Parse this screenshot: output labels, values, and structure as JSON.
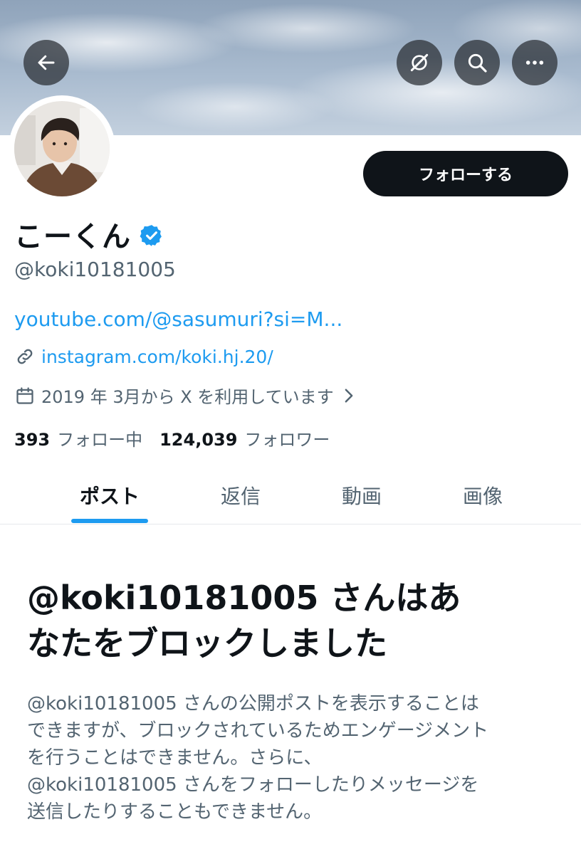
{
  "header": {
    "back_icon": "arrow-left-icon",
    "grok_icon": "grok-icon",
    "search_icon": "search-icon",
    "more_icon": "more-horizontal-icon"
  },
  "profile": {
    "display_name": "こーくん",
    "verified_icon": "verified-badge-icon",
    "handle": "@koki10181005",
    "website": "youtube.com/@sasumuri?si=M...",
    "link": "instagram.com/koki.hj.20/",
    "joined": "2019 年 3月から X を利用しています",
    "follow_button": "フォローする",
    "following_count": "393",
    "following_label": "フォロー中",
    "followers_count": "124,039",
    "followers_label": "フォロワー"
  },
  "tabs": [
    {
      "label": "ポスト",
      "active": true
    },
    {
      "label": "返信",
      "active": false
    },
    {
      "label": "動画",
      "active": false
    },
    {
      "label": "画像",
      "active": false
    }
  ],
  "blocked": {
    "title_line1": "@koki10181005 さんはあ",
    "title_line2": "なたをブロックしました",
    "body_lines": [
      "@koki10181005 さんの公開ポストを表示することは",
      "できますが、ブロックされているためエンゲージメント",
      "を行うことはできません。さらに、",
      "@koki10181005 さんをフォローしたりメッセージを",
      "送信したりすることもできません。"
    ]
  },
  "colors": {
    "accent": "#1d9bf0",
    "text_primary": "#0f1419",
    "text_secondary": "#536471",
    "button_dark": "#0f1419"
  }
}
